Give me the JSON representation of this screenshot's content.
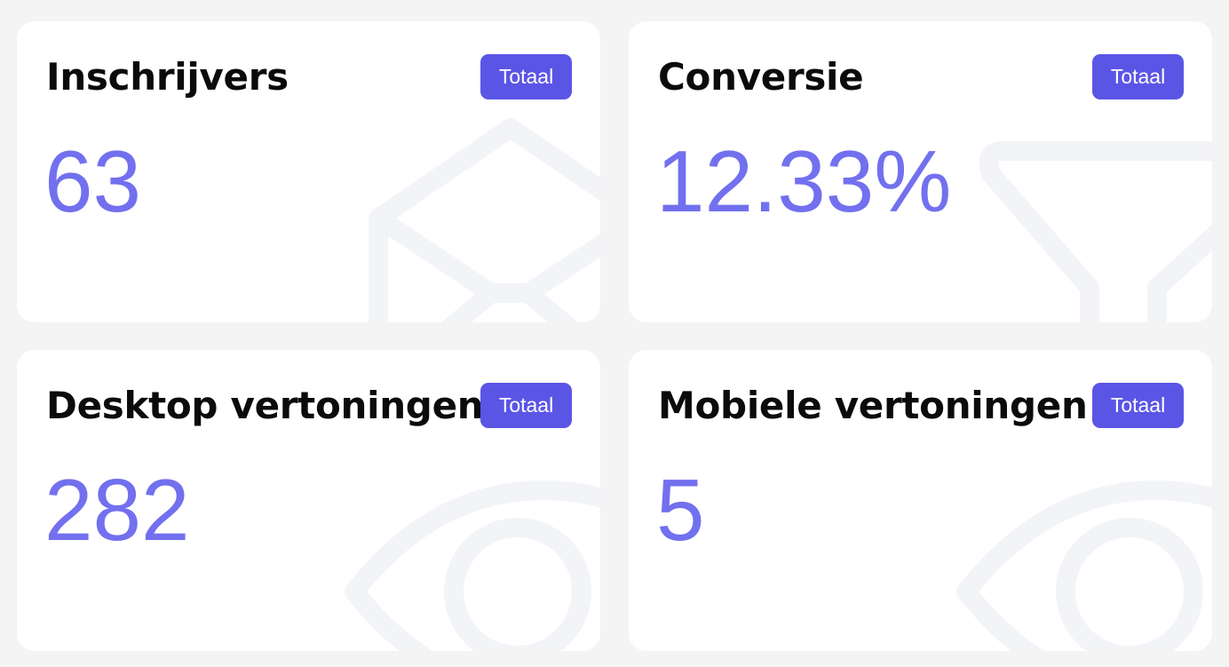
{
  "accent_color": "#5b55e6",
  "metric_color": "#7270ee",
  "cards": [
    {
      "title": "Inschrijvers",
      "badge": "Totaal",
      "value": "63",
      "icon": "envelope-icon"
    },
    {
      "title": "Conversie",
      "badge": "Totaal",
      "value": "12.33%",
      "icon": "funnel-icon"
    },
    {
      "title": "Desktop vertoningen",
      "badge": "Totaal",
      "value": "282",
      "icon": "eye-icon"
    },
    {
      "title": "Mobiele vertoningen",
      "badge": "Totaal",
      "value": "5",
      "icon": "eye-icon"
    }
  ]
}
